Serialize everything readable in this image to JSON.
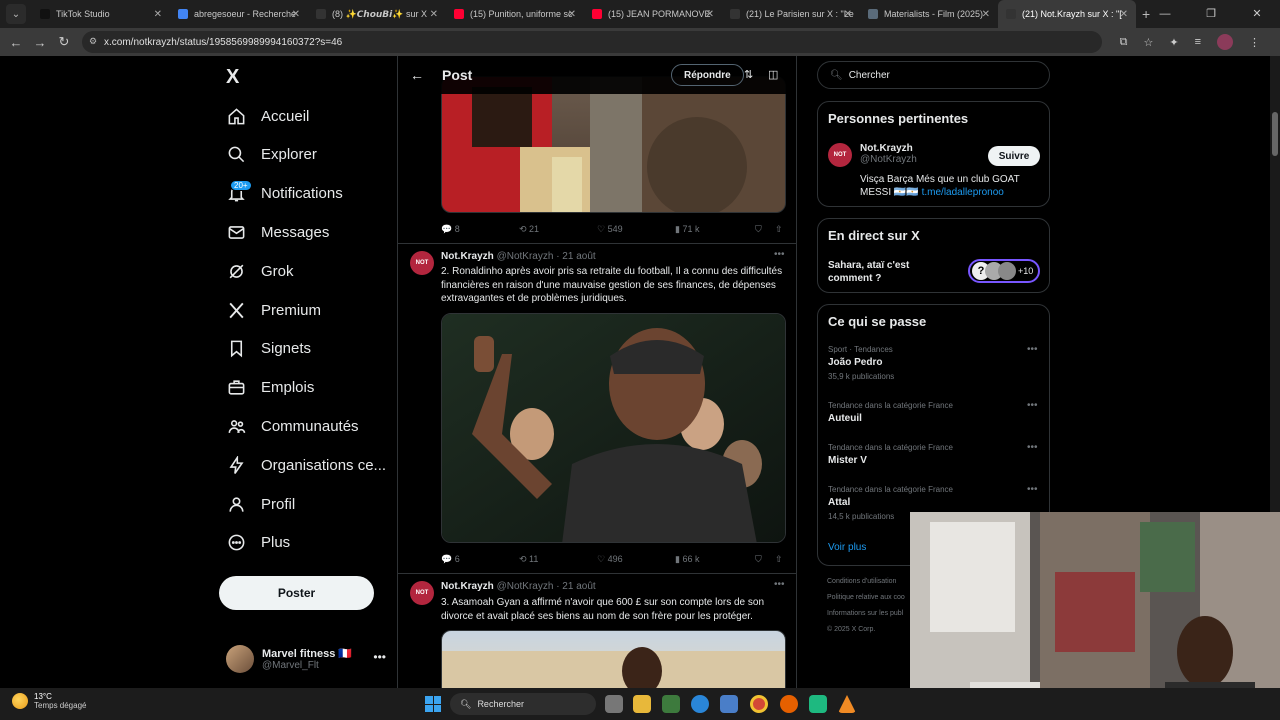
{
  "browser": {
    "tabs": [
      {
        "title": "TikTok Studio",
        "color": "#111111"
      },
      {
        "title": "abregesoeur - Recherche",
        "color": "#4285f4"
      },
      {
        "title": "(8) ✨𝘾𝙝𝙤𝙪𝘽𝙞✨ sur X",
        "color": "#333333"
      },
      {
        "title": "(15) Punition, uniforme sc",
        "color": "#ff0033"
      },
      {
        "title": "(15) JEAN PORMANOVE",
        "color": "#ff0033"
      },
      {
        "title": "(21) Le Parisien sur X : \"Le",
        "color": "#333333"
      },
      {
        "title": "Materialists - Film (2025)",
        "color": "#5a6b7a"
      },
      {
        "title": "(21) Not.Krayzh sur X : \"[",
        "color": "#333333"
      }
    ],
    "active_tab": 7,
    "url": "x.com/notkrayzh/status/1958569989994160372?s=46"
  },
  "sidebar": {
    "logo": "X",
    "items": [
      {
        "label": "Accueil",
        "icon": "home-icon"
      },
      {
        "label": "Explorer",
        "icon": "search-icon"
      },
      {
        "label": "Notifications",
        "icon": "bell-icon",
        "badge": "20+"
      },
      {
        "label": "Messages",
        "icon": "mail-icon"
      },
      {
        "label": "Grok",
        "icon": "grok-icon"
      },
      {
        "label": "Premium",
        "icon": "x-premium-icon"
      },
      {
        "label": "Signets",
        "icon": "bookmark-icon"
      },
      {
        "label": "Emplois",
        "icon": "briefcase-icon"
      },
      {
        "label": "Communautés",
        "icon": "people-icon"
      },
      {
        "label": "Organisations ce...",
        "icon": "lightning-icon"
      },
      {
        "label": "Profil",
        "icon": "person-icon"
      },
      {
        "label": "Plus",
        "icon": "more-circle-icon"
      }
    ],
    "post_button": "Poster",
    "account": {
      "name": "Marvel fitness 🇫🇷",
      "handle": "@Marvel_Flt"
    }
  },
  "main": {
    "header": {
      "title": "Post",
      "reply_button": "Répondre"
    },
    "tweets": [
      {
        "stats": {
          "replies": "8",
          "reposts": "21",
          "likes": "549",
          "views": "71 k"
        }
      },
      {
        "name": "Not.Krayzh",
        "handle": "@NotKrayzh",
        "date": "· 21 août",
        "text": "2. Ronaldinho après avoir pris sa retraite du football, Il a connu des difficultés financières en raison d'une mauvaise gestion de ses finances, de dépenses extravagantes et de problèmes juridiques.",
        "stats": {
          "replies": "6",
          "reposts": "11",
          "likes": "496",
          "views": "66 k"
        }
      },
      {
        "name": "Not.Krayzh",
        "handle": "@NotKrayzh",
        "date": "· 21 août",
        "text": "3. Asamoah Gyan a affirmé n'avoir que 600 £ sur son compte lors de son divorce et avait placé ses biens au nom de son frère pour les protéger."
      }
    ],
    "avatar_text": "NOT"
  },
  "right": {
    "search_placeholder": "Chercher",
    "relevant": {
      "title": "Personnes pertinentes",
      "name": "Not.Krayzh",
      "handle": "@NotKrayzh",
      "bio": "Visça Barça Més que un club GOAT MESSI 🇦🇷🇦🇷",
      "link": "t.me/ladallepronoo",
      "follow": "Suivre"
    },
    "live": {
      "title": "En direct sur X",
      "text": "Sahara, ataï c'est comment ?",
      "count": "+10"
    },
    "trends": {
      "title": "Ce qui se passe",
      "items": [
        {
          "category": "Sport · Tendances",
          "name": "João Pedro",
          "count": "35,9 k publications"
        },
        {
          "category": "Tendance dans la catégorie France",
          "name": "Auteuil",
          "count": ""
        },
        {
          "category": "Tendance dans la catégorie France",
          "name": "Mister V",
          "count": ""
        },
        {
          "category": "Tendance dans la catégorie France",
          "name": "Attal",
          "count": "14,5 k publications"
        }
      ],
      "more": "Voir plus"
    },
    "footer": [
      "Conditions d'utilisation",
      "Politique relative aux coo",
      "Informations sur les publ",
      "© 2025 X Corp."
    ]
  },
  "taskbar": {
    "temperature": "13°C",
    "weather": "Temps dégagé",
    "search": "Rechercher"
  },
  "colors": {
    "accent": "#1d9bf0",
    "background": "#000000",
    "border": "#2f3336",
    "muted": "#71767b"
  }
}
